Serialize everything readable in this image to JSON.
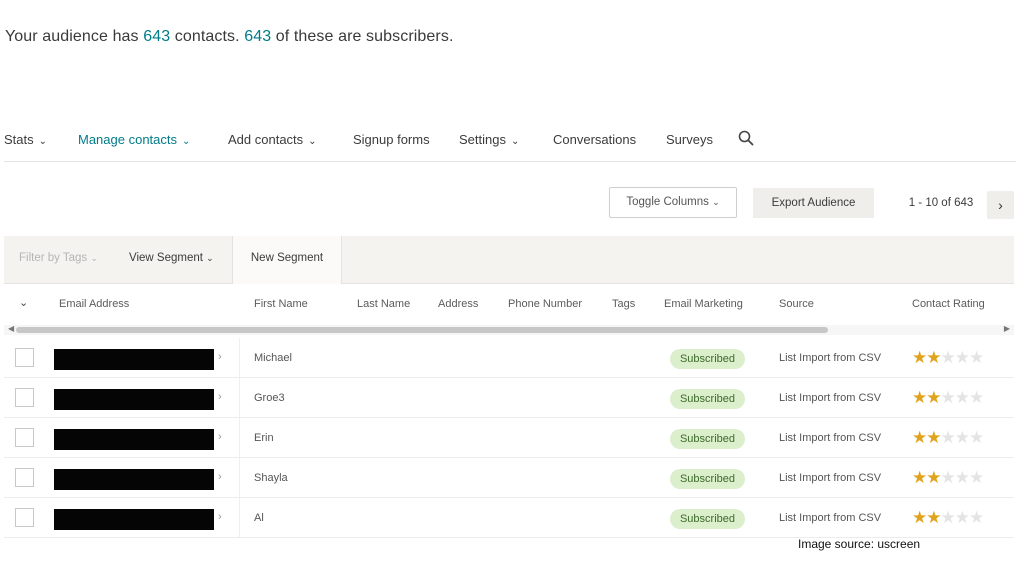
{
  "summary": {
    "prefix": "Your audience has ",
    "contacts_count": "643",
    "middle": " contacts. ",
    "subscribers_count": "643",
    "suffix": " of these are subscribers."
  },
  "nav": {
    "items": [
      {
        "label": "Stats",
        "has_dropdown": true
      },
      {
        "label": "Manage contacts",
        "has_dropdown": true,
        "active": true
      },
      {
        "label": "Add contacts",
        "has_dropdown": true
      },
      {
        "label": "Signup forms",
        "has_dropdown": false
      },
      {
        "label": "Settings",
        "has_dropdown": true
      },
      {
        "label": "Conversations",
        "has_dropdown": false
      },
      {
        "label": "Surveys",
        "has_dropdown": false
      }
    ],
    "search_icon": "search-icon"
  },
  "toolbar": {
    "toggle_columns": "Toggle Columns",
    "export": "Export Audience",
    "pagination": "1 - 10 of 643"
  },
  "filters": {
    "filter_by_tags": "Filter by Tags",
    "view_segment": "View Segment",
    "new_segment": "New Segment"
  },
  "table": {
    "columns": [
      "Email Address",
      "First Name",
      "Last Name",
      "Address",
      "Phone Number",
      "Tags",
      "Email Marketing",
      "Source",
      "Contact Rating"
    ],
    "rows": [
      {
        "first_name": "Michael",
        "email_marketing": "Subscribed",
        "source": "List Import from CSV",
        "rating": 2
      },
      {
        "first_name": "Groe3",
        "email_marketing": "Subscribed",
        "source": "List Import from CSV",
        "rating": 2
      },
      {
        "first_name": "Erin",
        "email_marketing": "Subscribed",
        "source": "List Import from CSV",
        "rating": 2
      },
      {
        "first_name": "Shayla",
        "email_marketing": "Subscribed",
        "source": "List Import from CSV",
        "rating": 2
      },
      {
        "first_name": "Al",
        "email_marketing": "Subscribed",
        "source": "List Import from CSV",
        "rating": 2
      }
    ],
    "rating_max": 5
  },
  "colors": {
    "accent": "#007c89",
    "subscribed_bg": "#dbefcc",
    "star_on": "#e0a31d"
  },
  "credit": "Image source: uscreen"
}
